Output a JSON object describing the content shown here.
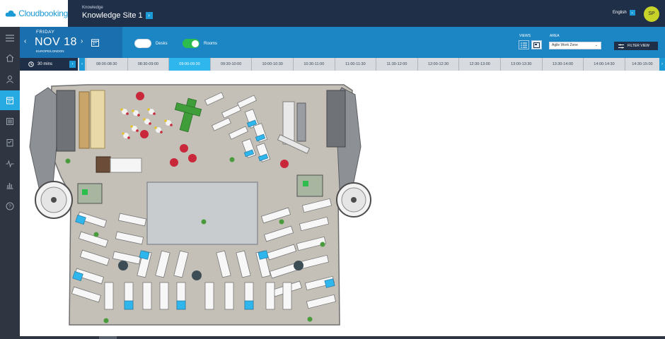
{
  "header": {
    "logo_text": "Cloudbooking",
    "site_label": "Knowledge",
    "site_name": "Knowledge Site 1",
    "language": "English",
    "user_initials": "SP"
  },
  "date_panel": {
    "weekday": "FRIDAY",
    "date": "NOV 18",
    "timezone": "EUROPE/LONDON"
  },
  "toggles": [
    {
      "label": "Desks",
      "on": false
    },
    {
      "label": "Rooms",
      "on": true
    }
  ],
  "views": {
    "label": "VIEWS",
    "options": [
      "list-view-icon",
      "floorplan-view-icon"
    ],
    "selected": "floorplan-view-icon"
  },
  "area": {
    "label": "AREA",
    "selected": "Agile Work Zone"
  },
  "filter_button": "FILTER VIEW",
  "timeline": {
    "interval": "30 mins",
    "slots": [
      "08:00-08:30",
      "08:30-09:00",
      "09:00-09:30",
      "09:30-10:00",
      "10:00-10:30",
      "10:30-11:00",
      "11:00-11:30",
      "11:30-12:00",
      "12:00-12:30",
      "12:30-13:00",
      "13:00-13:30",
      "13:30-14:00",
      "14:00-14:30",
      "14:30-15:00"
    ],
    "active_slot": "09:00-09:30"
  },
  "sidebar": {
    "items": [
      "menu-icon",
      "home-icon",
      "user-icon",
      "calendar-icon",
      "list-icon",
      "checklist-icon",
      "activity-icon",
      "reports-icon",
      "help-icon"
    ],
    "active": "calendar-icon"
  },
  "colors": {
    "topbar": "#1f2f48",
    "datebar": "#1b86c3",
    "accent": "#27a9e1",
    "toggle_on": "#2dbd4e",
    "desk_blue": "#2fb6ec",
    "floor": "#bab6ad"
  }
}
